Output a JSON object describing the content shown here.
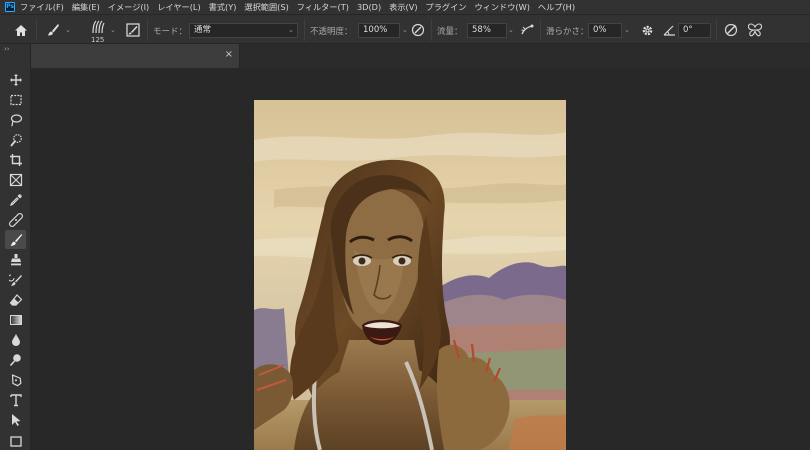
{
  "app": {
    "logo": "Ps"
  },
  "menu": {
    "items": [
      "ファイル(F)",
      "編集(E)",
      "イメージ(I)",
      "レイヤー(L)",
      "書式(Y)",
      "選択範囲(S)",
      "フィルター(T)",
      "3D(D)",
      "表示(V)",
      "プラグイン",
      "ウィンドウ(W)",
      "ヘルプ(H)"
    ]
  },
  "options": {
    "brush_size": "125",
    "mode_label": "モード：",
    "mode_value": "通常",
    "opacity_label": "不透明度：",
    "opacity_value": "100%",
    "flow_label": "流量：",
    "flow_value": "58%",
    "smoothing_label": "滑らかさ：",
    "smoothing_value": "0%",
    "angle_value": "0°"
  },
  "toolbar": {
    "collapse": "››",
    "active_tool": "brush-tool"
  },
  "document": {
    "close_glyph": "×"
  },
  "icons": [
    "home-icon",
    "brush-icon",
    "brush-preset-icon",
    "brush-panel-icon",
    "pressure-opacity-icon",
    "airbrush-icon",
    "settings-gear-icon",
    "angle-icon",
    "pressure-size-icon",
    "symmetry-butterfly-icon"
  ],
  "colors": {
    "accent": "#31a8ff",
    "panel": "#323232",
    "workspace": "#282828"
  }
}
